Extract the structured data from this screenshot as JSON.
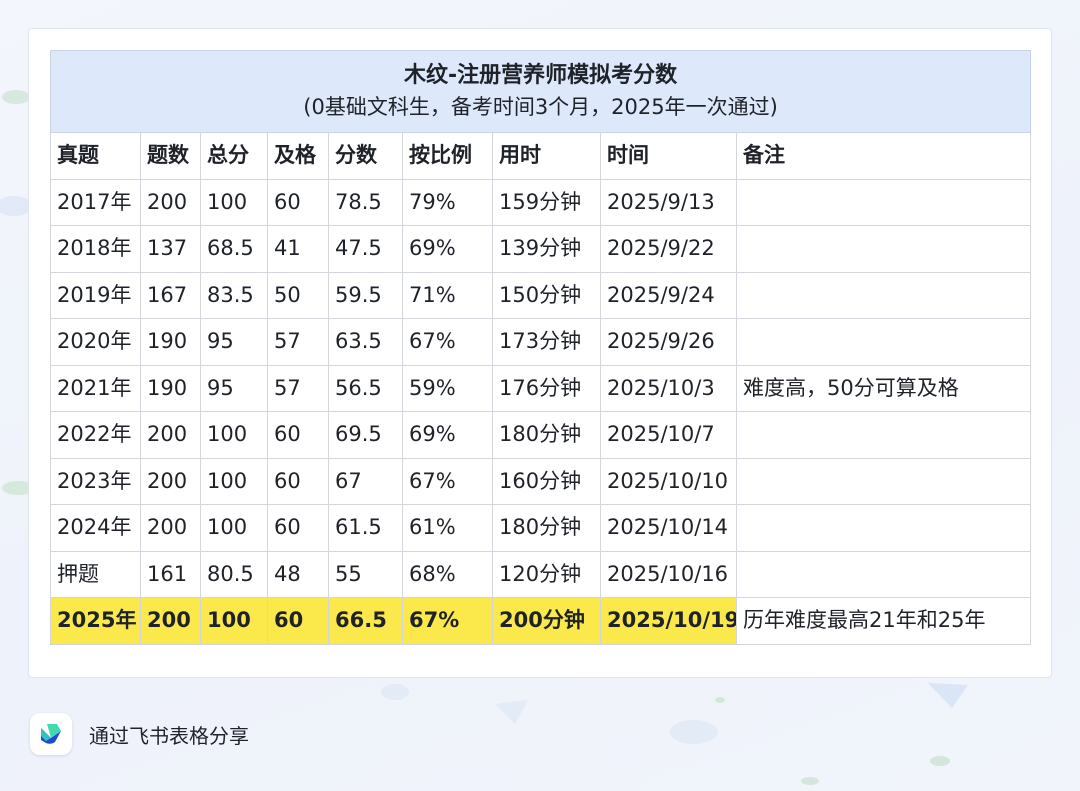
{
  "sheet": {
    "title": "木纹-注册营养师模拟考分数",
    "subtitle": "(0基础文科生，备考时间3个月，2025年一次通过)",
    "headers": [
      "真题",
      "题数",
      "总分",
      "及格",
      "分数",
      "按比例",
      "用时",
      "时间",
      "备注"
    ],
    "rows": [
      [
        "2017年",
        "200",
        "100",
        "60",
        "78.5",
        "79%",
        "159分钟",
        "2025/9/13",
        ""
      ],
      [
        "2018年",
        "137",
        "68.5",
        "41",
        "47.5",
        "69%",
        "139分钟",
        "2025/9/22",
        ""
      ],
      [
        "2019年",
        "167",
        "83.5",
        "50",
        "59.5",
        "71%",
        "150分钟",
        "2025/9/24",
        ""
      ],
      [
        "2020年",
        "190",
        "95",
        "57",
        "63.5",
        "67%",
        "173分钟",
        "2025/9/26",
        ""
      ],
      [
        "2021年",
        "190",
        "95",
        "57",
        "56.5",
        "59%",
        "176分钟",
        "2025/10/3",
        "难度高，50分可算及格"
      ],
      [
        "2022年",
        "200",
        "100",
        "60",
        "69.5",
        "69%",
        "180分钟",
        "2025/10/7",
        ""
      ],
      [
        "2023年",
        "200",
        "100",
        "60",
        "67",
        "67%",
        "160分钟",
        "2025/10/10",
        ""
      ],
      [
        "2024年",
        "200",
        "100",
        "60",
        "61.5",
        "61%",
        "180分钟",
        "2025/10/14",
        ""
      ],
      [
        "押题",
        "161",
        "80.5",
        "48",
        "55",
        "68%",
        "120分钟",
        "2025/10/16",
        ""
      ],
      [
        "2025年",
        "200",
        "100",
        "60",
        "66.5",
        "67%",
        "200分钟",
        "2025/10/19",
        "历年难度最高21年和25年"
      ]
    ],
    "highlight_color": "#fbe94c",
    "title_bg": "#dde8fb"
  },
  "footer": {
    "share_text": "通过飞书表格分享",
    "logo_icon": "feishu-logo-icon"
  }
}
